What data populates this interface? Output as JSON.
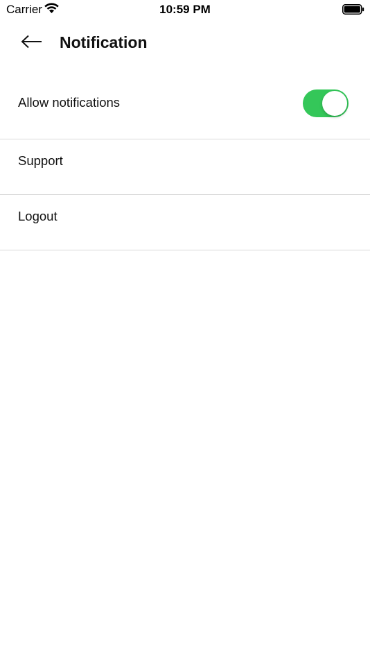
{
  "status_bar": {
    "carrier": "Carrier",
    "time": "10:59 PM",
    "wifi_icon": "wifi-icon",
    "battery_icon": "battery-icon"
  },
  "header": {
    "back_icon": "back-arrow-icon",
    "title": "Notification"
  },
  "settings": {
    "allow_notifications": {
      "label": "Allow notifications",
      "enabled": true
    },
    "support": {
      "label": "Support"
    },
    "logout": {
      "label": "Logout"
    }
  },
  "colors": {
    "toggle_on": "#34c759",
    "divider": "#d9d9d9"
  }
}
